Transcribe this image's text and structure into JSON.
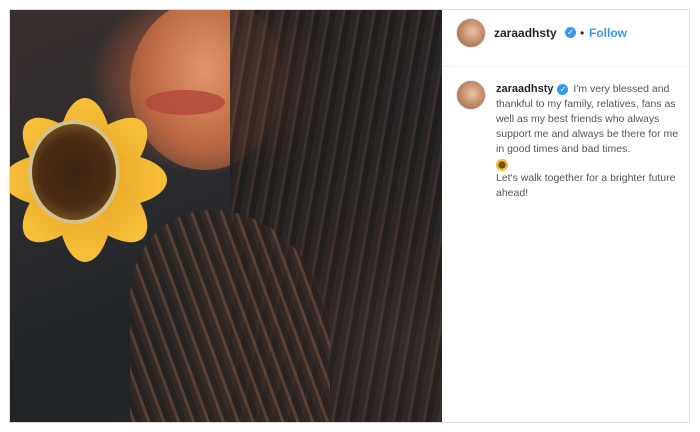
{
  "post": {
    "username": "zaraadhsty",
    "follow_label": "Follow",
    "separator": "•",
    "verified_glyph": "✓",
    "caption_text": "I'm very blessed and thankful to my family, relatives, fans as well as my best friends who always support me and always be there for me in good times and bad times.",
    "caption_text2": "Let's walk together for a brighter future ahead!",
    "emoji_icon": "sunflower-icon"
  }
}
